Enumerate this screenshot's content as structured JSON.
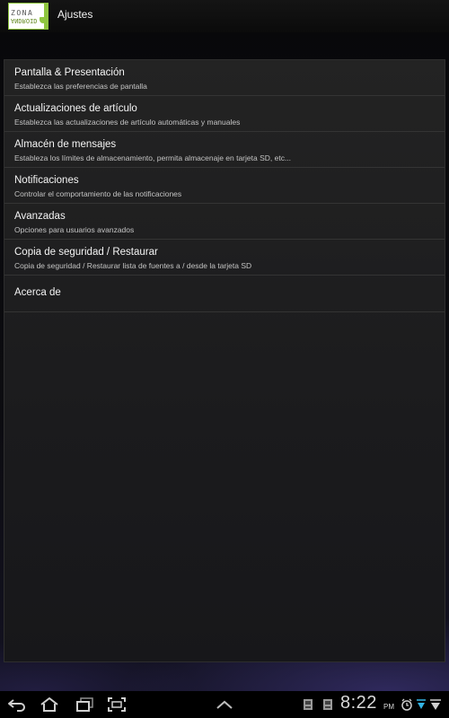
{
  "app": {
    "title": "Ajustes",
    "logo_top": "ZONA",
    "logo_bottom": "ANDROID"
  },
  "settings": [
    {
      "title": "Pantalla & Presentación",
      "summary": "Establezca las preferencias de pantalla"
    },
    {
      "title": "Actualizaciones de artículo",
      "summary": "Establezca las actualizaciones de artículo automáticas y manuales"
    },
    {
      "title": "Almacén de mensajes",
      "summary": "Estableza los límites de almacenamiento, permita almacenaje en tarjeta SD, etc..."
    },
    {
      "title": "Notificaciones",
      "summary": "Controlar el comportamiento de las notificaciones"
    },
    {
      "title": "Avanzadas",
      "summary": "Opciones para usuarios avanzados"
    },
    {
      "title": "Copia de seguridad / Restaurar",
      "summary": "Copia de seguridad / Restaurar lista de fuentes a / desde la tarjeta SD"
    },
    {
      "title": "Acerca de",
      "summary": ""
    }
  ],
  "system_bar": {
    "time": "8:22",
    "ampm": "PM",
    "icons": [
      "back-icon",
      "home-icon",
      "recent-apps-icon",
      "screenshot-icon",
      "menu-up-icon",
      "notification-app-icon",
      "notification-app-icon-2",
      "alarm-icon",
      "download-icon",
      "wifi-icon"
    ]
  },
  "colors": {
    "accent": "#8fc63f",
    "status_blue": "#33b5e5"
  }
}
